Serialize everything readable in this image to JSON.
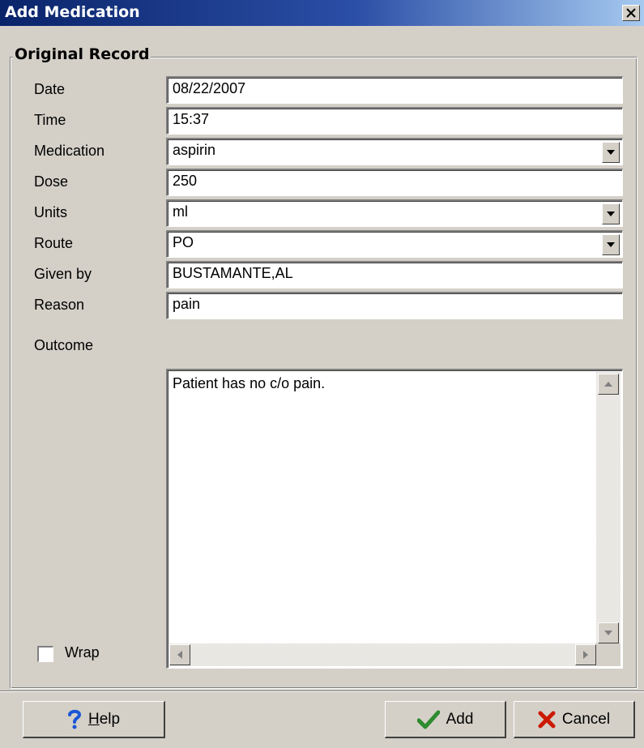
{
  "window": {
    "title": "Add Medication"
  },
  "group": {
    "label": "Original Record"
  },
  "fields": {
    "date": {
      "label": "Date",
      "value": "08/22/2007"
    },
    "time": {
      "label": "Time",
      "value": "15:37"
    },
    "medication": {
      "label": "Medication",
      "value": "aspirin"
    },
    "dose": {
      "label": "Dose",
      "value": "250"
    },
    "units": {
      "label": "Units",
      "value": "ml"
    },
    "route": {
      "label": "Route",
      "value": "PO"
    },
    "given_by": {
      "label": "Given by",
      "value": "BUSTAMANTE,AL"
    },
    "reason": {
      "label": "Reason",
      "value": "pain"
    },
    "outcome": {
      "label": "Outcome",
      "value": "Patient has no c/o pain."
    }
  },
  "wrap": {
    "label": "Wrap",
    "checked": false
  },
  "buttons": {
    "help": "Help",
    "help_accel": "H",
    "help_rest": "elp",
    "add": "Add",
    "cancel": "Cancel"
  },
  "icons": {
    "help": "question-mark-icon",
    "add": "checkmark-icon",
    "cancel": "red-x-icon",
    "close": "close-icon"
  },
  "colors": {
    "title_start": "#0a246a",
    "title_end": "#a6caf0",
    "face": "#d4d0c8",
    "help_icon": "#1a56d6",
    "check": "#2e8b2e",
    "cancel_x": "#cc1a00"
  }
}
